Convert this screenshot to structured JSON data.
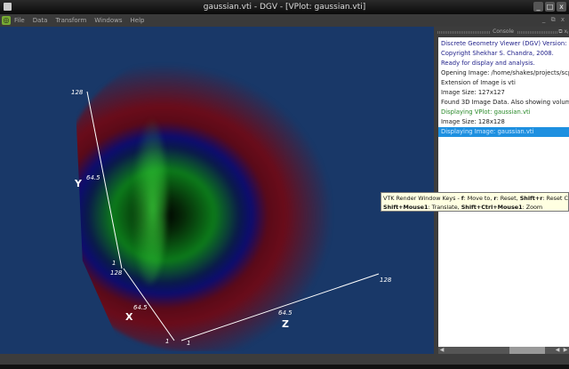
{
  "window": {
    "title": "gaussian.vti - DGV - [VPlot: gaussian.vti]",
    "buttons": [
      "_",
      "□",
      "x"
    ]
  },
  "menubar": {
    "items": [
      "File",
      "Data",
      "Transform",
      "Windows",
      "Help"
    ],
    "mdi_controls": "_ ⧉ x"
  },
  "render_view": {
    "background": "#193868",
    "axes": {
      "y": {
        "name": "Y",
        "ticks": [
          "128",
          "64.5",
          "1"
        ]
      },
      "x": {
        "name": "X",
        "ticks": [
          "128",
          "64.5",
          "1"
        ]
      },
      "z": {
        "name": "Z",
        "ticks": [
          "1",
          "64.5",
          "128"
        ]
      }
    }
  },
  "console": {
    "title": "Console",
    "controls": "⧉ x",
    "lines": [
      {
        "text": "Discrete Geometry Viewer (DGV) Version: 0.1",
        "style": "blue"
      },
      {
        "text": "Copyright Shekhar S. Chandra, 2008.",
        "style": "blue"
      },
      {
        "text": "Ready for display and analysis.",
        "style": "blue"
      },
      {
        "text": "Opening Image: /home/shakes/projects/scplus",
        "style": ""
      },
      {
        "text": "Extension of Image is vti",
        "style": ""
      },
      {
        "text": "Image Size: 127x127",
        "style": ""
      },
      {
        "text": "Found 3D Image Data. Also showing volume p",
        "style": ""
      },
      {
        "text": "Displaying VPlot: gaussian.vti",
        "style": "green"
      },
      {
        "text": "Image Size: 128x128",
        "style": ""
      },
      {
        "text": "Displaying Image: gaussian.vti",
        "style": "sel"
      }
    ]
  },
  "tooltip": {
    "line1": [
      {
        "t": "VTK Render Window Keys - ",
        "b": false
      },
      {
        "t": "f",
        "b": true
      },
      {
        "t": ": Move to, ",
        "b": false
      },
      {
        "t": "r",
        "b": true
      },
      {
        "t": ": Reset, ",
        "b": false
      },
      {
        "t": "Shift+r",
        "b": true
      },
      {
        "t": ": Reset Cam",
        "b": false
      }
    ],
    "line2": [
      {
        "t": "Shift+Mouse1",
        "b": true
      },
      {
        "t": ": Translate, ",
        "b": false
      },
      {
        "t": "Shift+Ctrl+Mouse1",
        "b": true
      },
      {
        "t": ": Zoom",
        "b": false
      }
    ]
  }
}
